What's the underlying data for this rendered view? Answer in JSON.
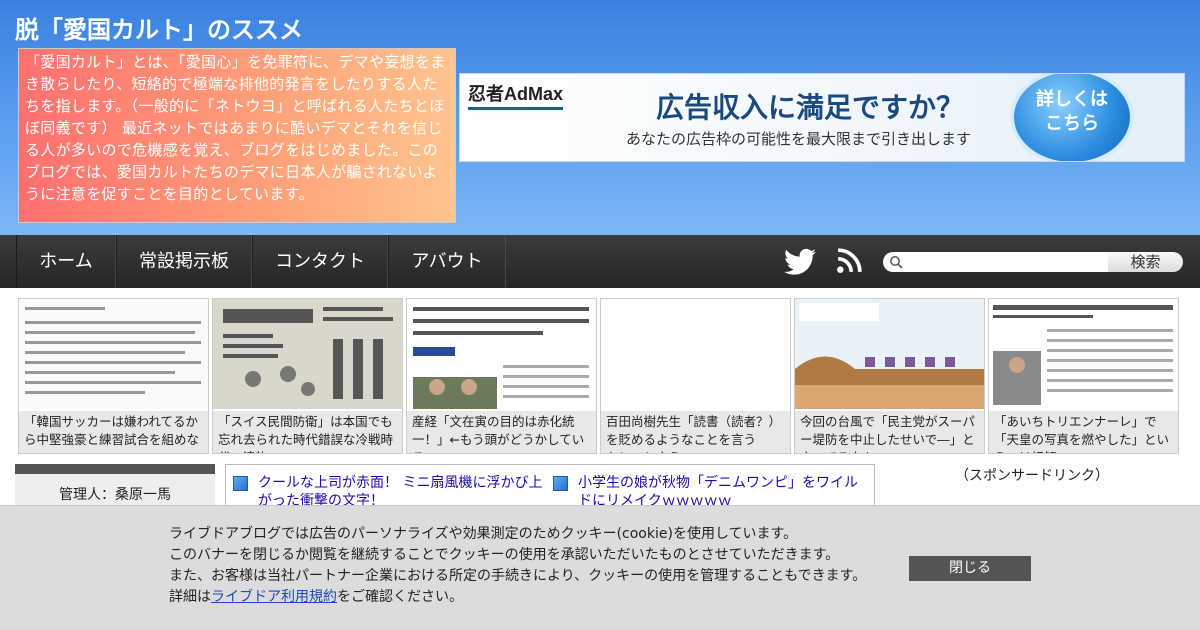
{
  "header": {
    "blog_title": "脱「愛国カルト」のススメ",
    "description": "「愛国カルト」とは、「愛国心」を免罪符に、デマや妄想をまき散らしたり、短絡的で極端な排他的発言をしたりする人たちを指します。（一般的に「ネトウヨ」と呼ばれる人たちとほぼ同義です） 最近ネットではあまりに酷いデマとそれを信じる人が多いので危機感を覚え、ブログをはじめました。このブログでは、愛国カルトたちのデマに日本人が騙されないように注意を促すことを目的としています。"
  },
  "ad_banner": {
    "brand": "忍者AdMax",
    "headline": "広告収入に満足ですか？",
    "subtext": "あなたの広告枠の可能性を最大限まで引き出します",
    "cta_line1": "詳しくは",
    "cta_line2": "こちら"
  },
  "nav": {
    "items": [
      "ホーム",
      "常設掲示板",
      "コンタクト",
      "アバウト"
    ],
    "twitter_icon": "twitter-icon",
    "rss_icon": "rss-icon",
    "search_placeholder": "",
    "search_button": "検索"
  },
  "thumbnails": [
    {
      "caption": "「韓国サッカーは嫌われてるから中堅強豪と練習試合を組めない」"
    },
    {
      "caption": "「スイス民間防衛」は本国でも忘れ去られた時代錯誤な冷戦時代の遺物"
    },
    {
      "caption": "産経「文在寅の目的は赤化統一！」←もう頭がどうかしている"
    },
    {
      "caption": "百田尚樹先生「読書（読者？）を貶めるようなことを言うな！」と言う"
    },
    {
      "caption": "今回の台風で「民主党がスーパー堤防を中止したせいで―」と言ってる人々"
    },
    {
      "caption": "「あいちトリエンナーレ」で「天皇の写真を燃やした」というのは誤解"
    }
  ],
  "sidebar": {
    "admin": "管理人：桑原一馬"
  },
  "ad_links": [
    {
      "text": "クールな上司が赤面！ ミニ扇風機に浮かび上がった衝撃の文字！"
    },
    {
      "text": "小学生の娘が秋物「デニムワンピ」をワイルドにリメイクｗｗｗｗｗ"
    }
  ],
  "sponsored_label": "（スポンサードリンク）",
  "cookie_banner": {
    "line1": "ライブドアブログでは広告のパーソナライズや効果測定のためクッキー(cookie)を使用しています。",
    "line2": "このバナーを閉じるか閲覧を継続することでクッキーの使用を承認いただいたものとさせていただきます。",
    "line3": "また、お客様は当社パートナー企業における所定の手続きにより、クッキーの使用を管理することもできます。",
    "line4_prefix": "詳細は",
    "line4_link": "ライブドア利用規約",
    "line4_suffix": "をご確認ください。",
    "close_button": "閉じる"
  },
  "colors": {
    "header_blue": "#3a80e0",
    "nav_dark": "#2e2e2e",
    "link_blue": "#1a0dab"
  }
}
